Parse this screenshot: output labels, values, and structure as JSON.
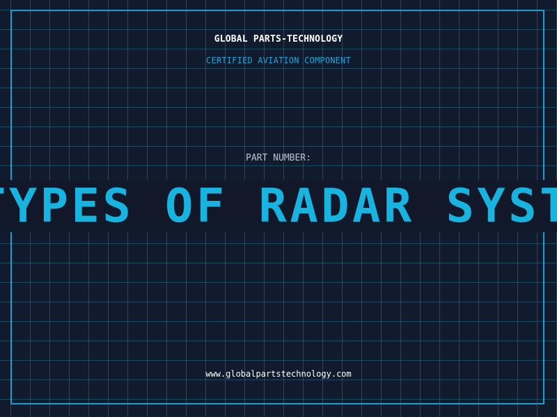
{
  "header": {
    "brand": "GLOBAL PARTS-TECHNOLOGY",
    "subtitle": "CERTIFIED AVIATION COMPONENT"
  },
  "part": {
    "label": "PART NUMBER:",
    "value": "TYPES OF RADAR SYSTEMS"
  },
  "footer": {
    "url": "www.globalpartstechnology.com"
  },
  "colors": {
    "background": "#111b2e",
    "grid": "#29708c",
    "frame": "#1b9fd0",
    "accent": "#19b3e0",
    "band": "#101829"
  }
}
